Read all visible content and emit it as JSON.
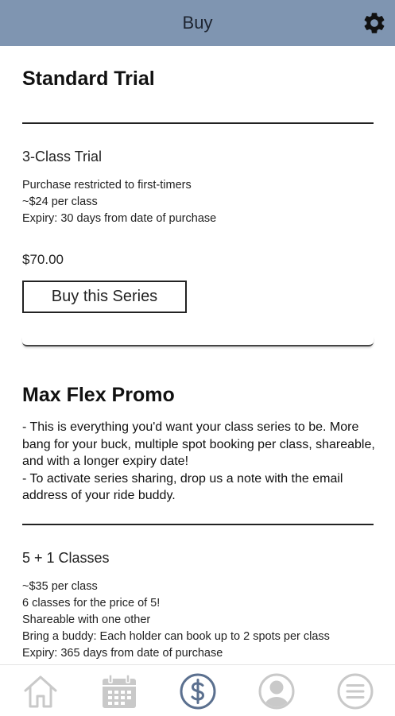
{
  "header": {
    "title": "Buy",
    "settings_icon": "gear-icon"
  },
  "sections": [
    {
      "title": "Standard Trial",
      "items": [
        {
          "title": "3-Class Trial",
          "details": [
            "Purchase restricted to first-timers",
            "~$24 per class",
            "Expiry: 30 days from date of purchase"
          ],
          "price": "$70.00",
          "button_label": "Buy this Series"
        }
      ]
    },
    {
      "title": "Max Flex Promo",
      "description": [
        "- This is everything you'd want your class series to be. More bang for your buck, multiple spot booking per class, shareable, and with a longer expiry date!",
        "- To activate series sharing, drop us a note with the email address of your ride buddy."
      ],
      "items": [
        {
          "title": "5 + 1 Classes",
          "details": [
            "~$35 per class",
            "6 classes for the price of 5!",
            "Shareable with one other",
            "Bring a buddy: Each holder can book up to 2 spots per class",
            "Expiry: 365 days from date of purchase"
          ]
        }
      ]
    }
  ],
  "bottom_nav": [
    {
      "name": "home",
      "icon": "home-icon",
      "active": false
    },
    {
      "name": "schedule",
      "icon": "calendar-icon",
      "active": false
    },
    {
      "name": "buy",
      "icon": "dollar-icon",
      "active": true
    },
    {
      "name": "profile",
      "icon": "user-icon",
      "active": false
    },
    {
      "name": "menu",
      "icon": "menu-icon",
      "active": false
    }
  ],
  "colors": {
    "header_bg": "#7f95b1",
    "nav_active": "#5b708f",
    "nav_inactive": "#c9c9c9"
  }
}
